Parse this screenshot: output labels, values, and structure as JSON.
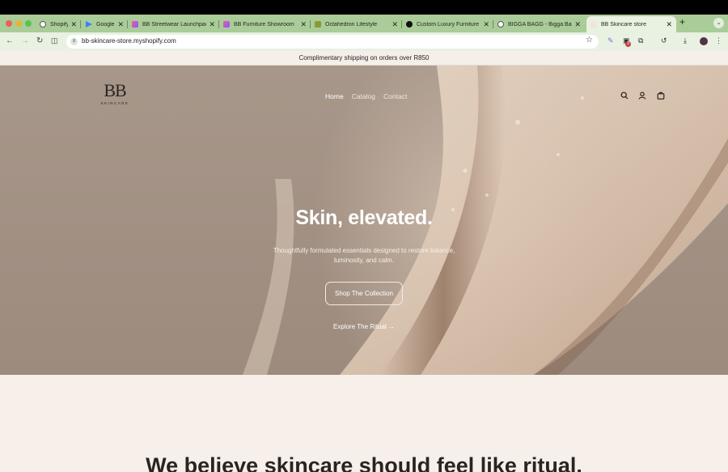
{
  "browser": {
    "tabs": [
      {
        "title": "Shopify",
        "active": false
      },
      {
        "title": "Google",
        "active": false
      },
      {
        "title": "BB Streetwear Launchpad",
        "active": false
      },
      {
        "title": "BB Furniture Showroom",
        "active": false
      },
      {
        "title": "Octahedron Lifestyle",
        "active": false
      },
      {
        "title": "Custom Luxury Furniture",
        "active": false
      },
      {
        "title": "BIGGA BAGG - Bigga Bagg",
        "active": false
      },
      {
        "title": "BB Skincare store",
        "active": true
      }
    ],
    "url": "bb-skincare-store.myshopify.com",
    "extension_badge": "3",
    "accent_color": "#a9cc98"
  },
  "announcement": "Complimentary shipping on orders over R850",
  "header": {
    "logo_mark": "BB",
    "logo_word": "SKINCARE",
    "menu": [
      "Home",
      "Catalog",
      "Contact"
    ],
    "current": "Home"
  },
  "hero": {
    "headline": "Skin, elevated.",
    "subtext": "Thoughtfully formulated essentials designed to restore balance, luminosity, and calm.",
    "cta": "Shop The Collection",
    "secondary_link": "Explore The Ritual →"
  },
  "lower": {
    "heading": "We believe skincare should feel like ritual."
  }
}
